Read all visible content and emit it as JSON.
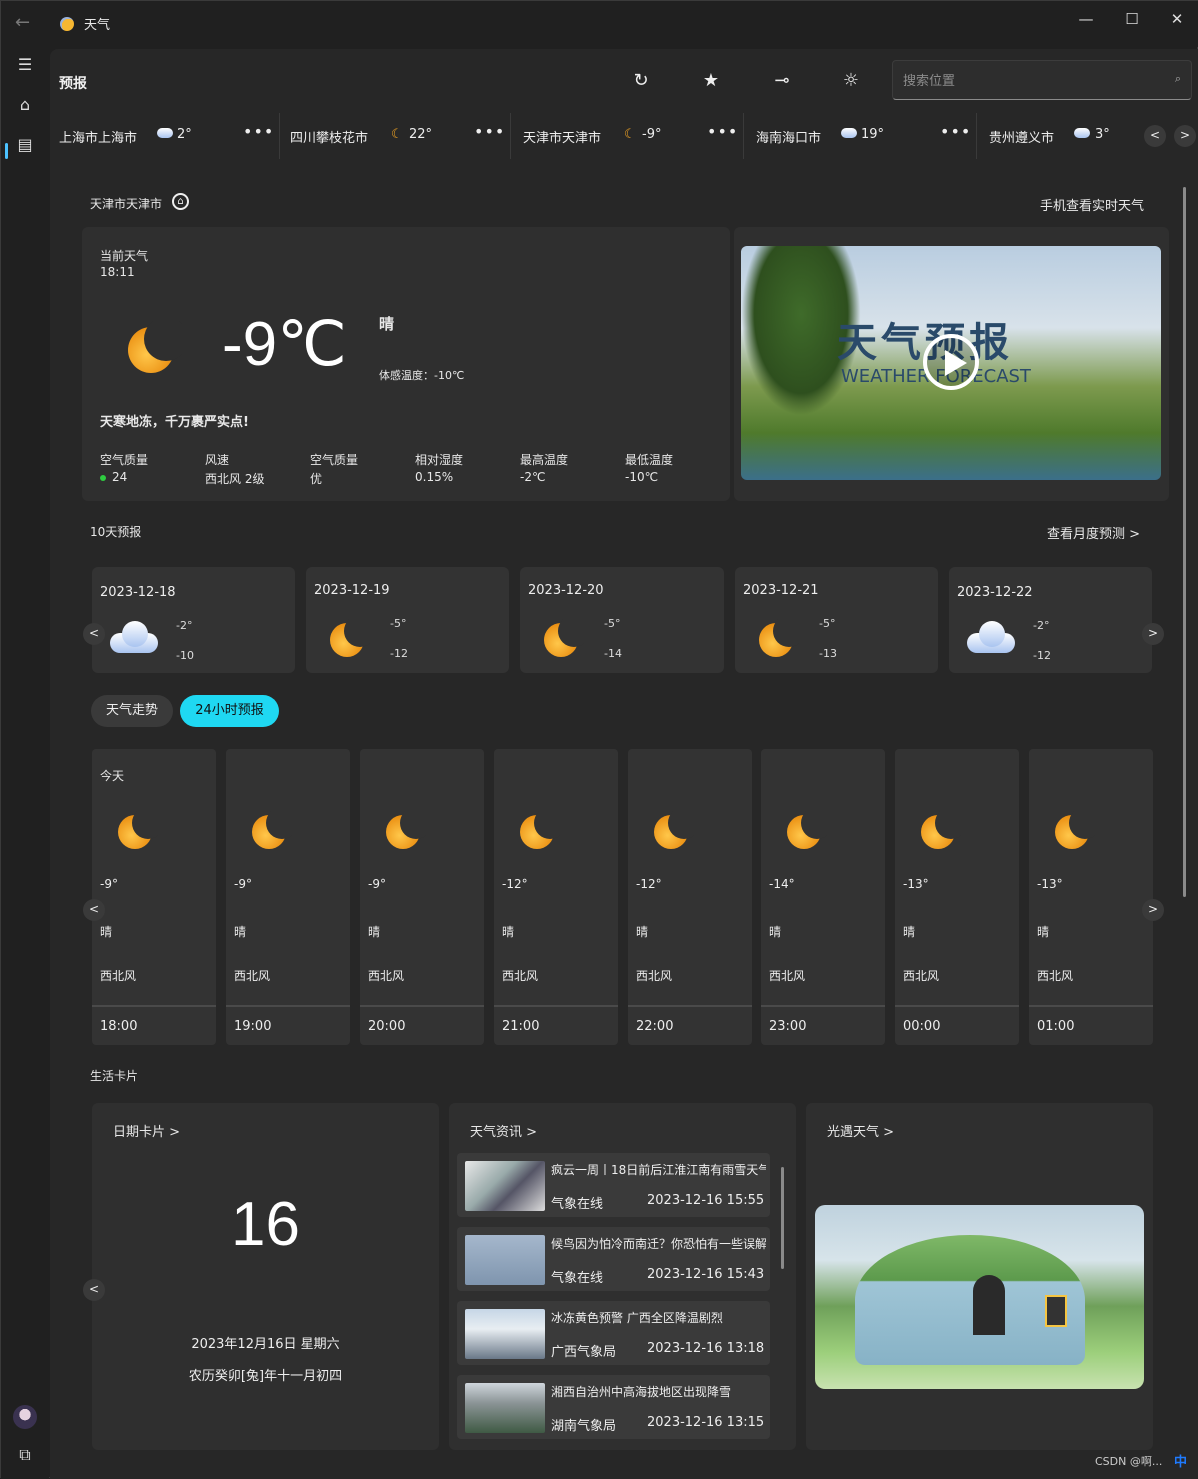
{
  "titlebar": {
    "app_title": "天气",
    "minimize": "—",
    "maximize": "☐",
    "close": "✕"
  },
  "command": {
    "title": "预报",
    "search_placeholder": "搜索位置"
  },
  "cities": [
    {
      "name": "上海市上海市",
      "temp": "2°",
      "icon": "cloud-icon"
    },
    {
      "name": "四川攀枝花市",
      "temp": "22°",
      "icon": "moon-icon"
    },
    {
      "name": "天津市天津市",
      "temp": "-9°",
      "icon": "moon-icon"
    },
    {
      "name": "海南海口市",
      "temp": "19°",
      "icon": "cloud-icon"
    },
    {
      "name": "贵州遵义市",
      "temp": "3°",
      "icon": "cloud-icon"
    }
  ],
  "location": {
    "name": "天津市天津市",
    "phone_link": "手机查看实时天气"
  },
  "current": {
    "label": "当前天气",
    "time": "18:11",
    "temp": "-9℃",
    "condition": "晴",
    "feels_like": "体感温度：-10℃",
    "tip": "天寒地冻，千万裹严实点!",
    "stats": [
      {
        "label": "空气质量",
        "value": "24",
        "dot_color": "#2ecc40"
      },
      {
        "label": "风速",
        "value": "西北风 2级"
      },
      {
        "label": "空气质量",
        "value": "优"
      },
      {
        "label": "相对湿度",
        "value": "0.15%"
      },
      {
        "label": "最高温度",
        "value": "-2℃"
      },
      {
        "label": "最低温度",
        "value": "-10℃"
      }
    ]
  },
  "video": {
    "title_cn": "天气预报",
    "title_en": "WEATHER FORECAST"
  },
  "forecast": {
    "label": "10天预报",
    "monthly_link": "查看月度预测 >",
    "days": [
      {
        "date": "2023-12-18",
        "high": "-2°",
        "low": "-10",
        "icon": "cloud-icon"
      },
      {
        "date": "2023-12-19",
        "high": "-5°",
        "low": "-12",
        "icon": "moon-icon"
      },
      {
        "date": "2023-12-20",
        "high": "-5°",
        "low": "-14",
        "icon": "moon-icon"
      },
      {
        "date": "2023-12-21",
        "high": "-5°",
        "low": "-13",
        "icon": "moon-icon"
      },
      {
        "date": "2023-12-22",
        "high": "-2°",
        "low": "-12",
        "icon": "cloud-icon"
      }
    ]
  },
  "tabs": {
    "trend": "天气走势",
    "hourly": "24小时预报"
  },
  "hourly": [
    {
      "day": "今天",
      "temp": "-9°",
      "cond": "晴",
      "wind": "西北风",
      "hour": "18:00"
    },
    {
      "day": "",
      "temp": "-9°",
      "cond": "晴",
      "wind": "西北风",
      "hour": "19:00"
    },
    {
      "day": "",
      "temp": "-9°",
      "cond": "晴",
      "wind": "西北风",
      "hour": "20:00"
    },
    {
      "day": "",
      "temp": "-12°",
      "cond": "晴",
      "wind": "西北风",
      "hour": "21:00"
    },
    {
      "day": "",
      "temp": "-12°",
      "cond": "晴",
      "wind": "西北风",
      "hour": "22:00"
    },
    {
      "day": "",
      "temp": "-14°",
      "cond": "晴",
      "wind": "西北风",
      "hour": "23:00"
    },
    {
      "day": "",
      "temp": "-13°",
      "cond": "晴",
      "wind": "西北风",
      "hour": "00:00"
    },
    {
      "day": "",
      "temp": "-13°",
      "cond": "晴",
      "wind": "西北风",
      "hour": "01:00"
    }
  ],
  "life": {
    "label": "生活卡片",
    "date_card": {
      "title": "日期卡片 >",
      "day": "16",
      "full_date": "2023年12月16日 星期六",
      "lunar": "农历癸卯[兔]年十一月初四"
    },
    "news_card": {
      "title": "天气资讯 >",
      "items": [
        {
          "title": "疯云一周丨18日前后江淮江南有雨雪天气",
          "source": "气象在线",
          "date": "2023-12-16 15:55"
        },
        {
          "title": "候鸟因为怕冷而南迁？你恐怕有一些误解",
          "source": "气象在线",
          "date": "2023-12-16 15:43"
        },
        {
          "title": "冰冻黄色预警 广西全区降温剧烈",
          "source": "广西气象局",
          "date": "2023-12-16 13:18"
        },
        {
          "title": "湘西自治州中高海拔地区出现降雪",
          "source": "湖南气象局",
          "date": "2023-12-16 13:15"
        }
      ]
    },
    "sky_card": {
      "title": "光遇天气 >"
    }
  },
  "watermark": "CSDN @啊...",
  "ime": "中",
  "colors": {
    "accent": "#1fd8f2",
    "background": "#272727",
    "card": "#2f2f2f"
  }
}
